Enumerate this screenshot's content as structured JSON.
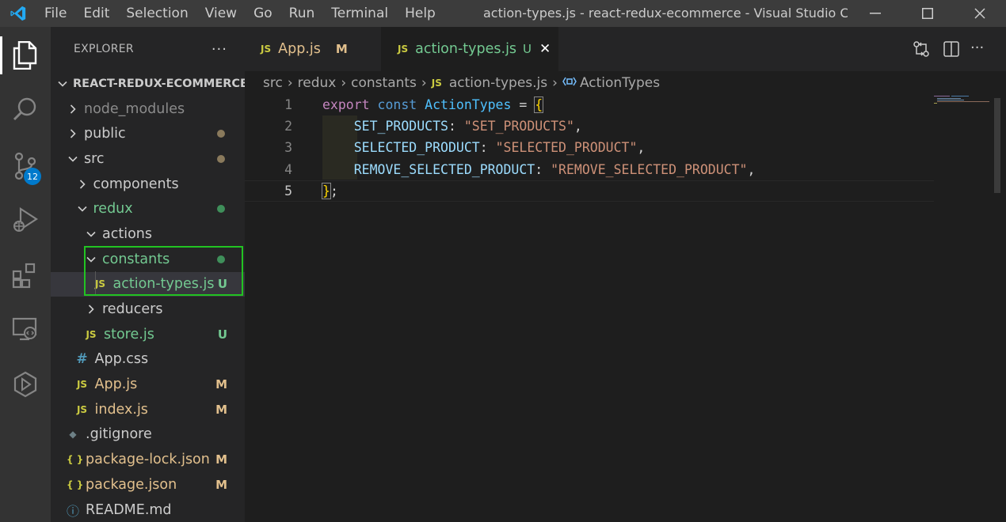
{
  "window": {
    "title": "action-types.js - react-redux-ecommerce - Visual Studio C...",
    "menu": [
      "File",
      "Edit",
      "Selection",
      "View",
      "Go",
      "Run",
      "Terminal",
      "Help"
    ]
  },
  "activity_bar": {
    "items": [
      "explorer-icon",
      "search-icon",
      "source-control-icon",
      "run-debug-icon",
      "extensions-icon",
      "remote-explorer-icon",
      "live-share-icon"
    ],
    "source_control_badge": "12"
  },
  "sidebar": {
    "title": "EXPLORER",
    "more": "···",
    "root": "REACT-REDUX-ECOMMERCE",
    "items": [
      {
        "label": "node_modules",
        "type": "folder",
        "expanded": false,
        "depth": 1,
        "status": "",
        "color": "#8b8b8b"
      },
      {
        "label": "public",
        "type": "folder",
        "expanded": false,
        "depth": 1,
        "status": "dot",
        "color": "#cccccc",
        "dot_color": "#8a7a5c"
      },
      {
        "label": "src",
        "type": "folder",
        "expanded": true,
        "depth": 1,
        "status": "dot",
        "color": "#cccccc",
        "dot_color": "#8a7a5c"
      },
      {
        "label": "components",
        "type": "folder",
        "expanded": false,
        "depth": 2,
        "status": "",
        "color": "#cccccc"
      },
      {
        "label": "redux",
        "type": "folder",
        "expanded": true,
        "depth": 2,
        "status": "dot",
        "color": "#73c991",
        "dot_color": "#3f8f5a"
      },
      {
        "label": "actions",
        "type": "folder",
        "expanded": true,
        "depth": 3,
        "status": "",
        "color": "#cccccc"
      },
      {
        "label": "constants",
        "type": "folder",
        "expanded": true,
        "depth": 3,
        "status": "dot",
        "color": "#73c991",
        "dot_color": "#3f8f5a"
      },
      {
        "label": "action-types.js",
        "type": "js",
        "depth": 4,
        "status": "U",
        "color": "#73c991",
        "selected": true
      },
      {
        "label": "reducers",
        "type": "folder",
        "expanded": false,
        "depth": 3,
        "status": "",
        "color": "#cccccc"
      },
      {
        "label": "store.js",
        "type": "js",
        "depth": 3,
        "status": "U",
        "color": "#73c991"
      },
      {
        "label": "App.css",
        "type": "css",
        "depth": 2,
        "status": "",
        "color": "#cccccc"
      },
      {
        "label": "App.js",
        "type": "js",
        "depth": 2,
        "status": "M",
        "color": "#e2c08d"
      },
      {
        "label": "index.js",
        "type": "js",
        "depth": 2,
        "status": "M",
        "color": "#e2c08d"
      },
      {
        "label": ".gitignore",
        "type": "git",
        "depth": 1,
        "status": "",
        "color": "#cccccc"
      },
      {
        "label": "package-lock.json",
        "type": "json",
        "depth": 1,
        "status": "M",
        "color": "#e2c08d"
      },
      {
        "label": "package.json",
        "type": "json",
        "depth": 1,
        "status": "M",
        "color": "#e2c08d"
      },
      {
        "label": "README.md",
        "type": "info",
        "depth": 1,
        "status": "",
        "color": "#cccccc"
      }
    ]
  },
  "tabs": [
    {
      "label": "App.js",
      "icon": "JS",
      "status": "M",
      "active": false
    },
    {
      "label": "action-types.js",
      "icon": "JS",
      "status": "U",
      "active": true,
      "close": "✕"
    }
  ],
  "breadcrumbs": [
    "src",
    "redux",
    "constants",
    "action-types.js",
    "ActionTypes"
  ],
  "editor": {
    "lines": [
      {
        "n": "1",
        "tokens": [
          [
            "kw",
            "export"
          ],
          [
            "pun",
            " "
          ],
          [
            "st",
            "const"
          ],
          [
            "pun",
            " "
          ],
          [
            "id",
            "ActionTypes"
          ],
          [
            "pun",
            " = "
          ],
          [
            "brace",
            "{"
          ]
        ]
      },
      {
        "n": "2",
        "tokens": [
          [
            "pun",
            "    "
          ],
          [
            "prop",
            "SET_PRODUCTS"
          ],
          [
            "pun",
            ": "
          ],
          [
            "str",
            "\"SET_PRODUCTS\""
          ],
          [
            "pun",
            ","
          ]
        ]
      },
      {
        "n": "3",
        "tokens": [
          [
            "pun",
            "    "
          ],
          [
            "prop",
            "SELECTED_PRODUCT"
          ],
          [
            "pun",
            ": "
          ],
          [
            "str",
            "\"SELECTED_PRODUCT\""
          ],
          [
            "pun",
            ","
          ]
        ]
      },
      {
        "n": "4",
        "tokens": [
          [
            "pun",
            "    "
          ],
          [
            "prop",
            "REMOVE_SELECTED_PRODUCT"
          ],
          [
            "pun",
            ": "
          ],
          [
            "str",
            "\"REMOVE_SELECTED_PRODUCT\""
          ],
          [
            "pun",
            ","
          ]
        ]
      },
      {
        "n": "5",
        "tokens": [
          [
            "brace",
            "}"
          ],
          [
            "pun",
            ";"
          ]
        ]
      }
    ],
    "current_line": 5
  },
  "colors": {
    "accent": "#007acc",
    "highlight_box": "#22c322",
    "untracked": "#73c991",
    "modified": "#e2c08d"
  }
}
